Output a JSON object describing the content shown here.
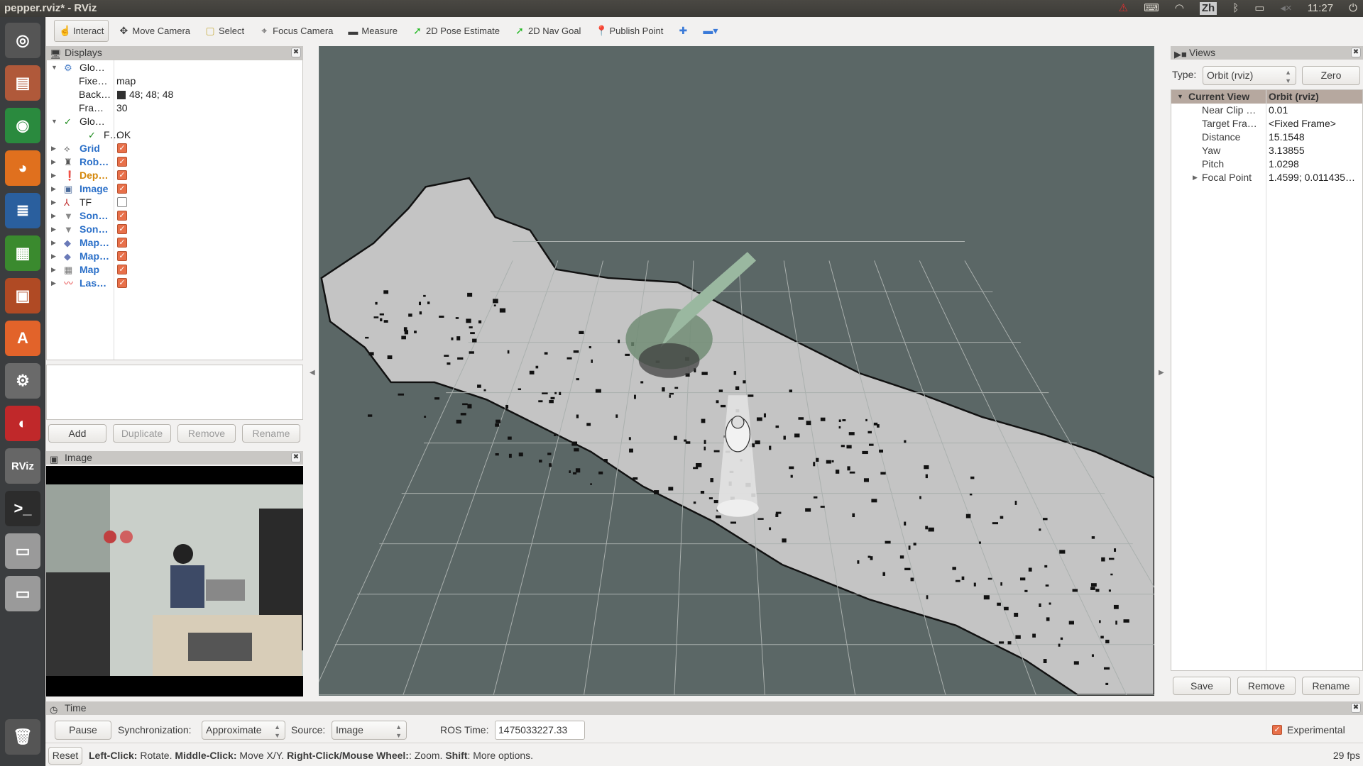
{
  "window": {
    "title": "pepper.rviz* - RViz"
  },
  "tray": {
    "clock": "11:27",
    "input_method": "Zh"
  },
  "launcher": [
    {
      "name": "ubuntu-dash",
      "glyph": "◎",
      "color": "#555"
    },
    {
      "name": "files",
      "glyph": "▤",
      "color": "#b0593a"
    },
    {
      "name": "chrome",
      "glyph": "◉",
      "color": "#2a8a3e"
    },
    {
      "name": "firefox",
      "glyph": "◕",
      "color": "#e0701e"
    },
    {
      "name": "writer",
      "glyph": "≣",
      "color": "#2a5f9e"
    },
    {
      "name": "calc",
      "glyph": "▦",
      "color": "#3a8a2e"
    },
    {
      "name": "impress",
      "glyph": "▣",
      "color": "#b04a24"
    },
    {
      "name": "software-center",
      "glyph": "A",
      "color": "#e2632a"
    },
    {
      "name": "system-settings",
      "glyph": "⚙",
      "color": "#6a6a6a"
    },
    {
      "name": "backup",
      "glyph": "◐",
      "color": "#c0282a"
    },
    {
      "name": "rviz",
      "glyph": "RViz",
      "color": "#666"
    },
    {
      "name": "terminal",
      "glyph": ">_",
      "color": "#2c2c2c"
    },
    {
      "name": "drive-1",
      "glyph": "▭",
      "color": "#9a9a9a"
    },
    {
      "name": "drive-2",
      "glyph": "▭",
      "color": "#9a9a9a"
    }
  ],
  "toolbar": [
    {
      "label": "Interact",
      "icon": "hand-icon",
      "glyph": "☝",
      "active": true
    },
    {
      "label": "Move Camera",
      "icon": "move-camera-icon",
      "glyph": "✥"
    },
    {
      "label": "Select",
      "icon": "select-icon",
      "glyph": "▢"
    },
    {
      "label": "Focus Camera",
      "icon": "focus-camera-icon",
      "glyph": "⌖"
    },
    {
      "label": "Measure",
      "icon": "ruler-icon",
      "glyph": "▬"
    },
    {
      "label": "2D Pose Estimate",
      "icon": "pose-arrow-icon",
      "glyph": "➚"
    },
    {
      "label": "2D Nav Goal",
      "icon": "nav-arrow-icon",
      "glyph": "➚"
    },
    {
      "label": "Publish Point",
      "icon": "map-pin-icon",
      "glyph": "📍"
    },
    {
      "label": "",
      "icon": "plus-icon",
      "glyph": "✚"
    },
    {
      "label": "",
      "icon": "minus-icon",
      "glyph": "▬▾"
    }
  ],
  "displays": {
    "title": "Displays",
    "rows": [
      {
        "label": "Glo…",
        "value": "",
        "indent": 0,
        "expand": "▼",
        "icon": "gear-icon",
        "glyph": "⚙",
        "color": "#222",
        "iconcolor": "#4a7fc8"
      },
      {
        "label": "Fixe…",
        "value": "map",
        "indent": 1,
        "color": "#222"
      },
      {
        "label": "Back…",
        "value": "48; 48; 48",
        "swatch": "#303030",
        "indent": 1,
        "color": "#222"
      },
      {
        "label": "Fra…",
        "value": "30",
        "indent": 1,
        "color": "#222"
      },
      {
        "label": "Glo…",
        "value": "",
        "indent": 0,
        "expand": "▼",
        "icon": "check-icon",
        "glyph": "✓",
        "color": "#222",
        "iconcolor": "#1c8a1c"
      },
      {
        "label": "F…",
        "value": "OK",
        "indent": 1,
        "icon": "check-icon",
        "glyph": "✓",
        "color": "#222",
        "iconcolor": "#1c8a1c"
      },
      {
        "label": "Grid",
        "checked": true,
        "indent": 0,
        "expand": "▶",
        "icon": "grid-icon",
        "glyph": "⟡",
        "color": "#2a6fc8",
        "bold": true
      },
      {
        "label": "Rob…",
        "checked": true,
        "indent": 0,
        "expand": "▶",
        "icon": "robot-model-icon",
        "glyph": "♜",
        "color": "#2a6fc8",
        "bold": true
      },
      {
        "label": "Dep…",
        "checked": true,
        "indent": 0,
        "expand": "▶",
        "icon": "warning-icon",
        "glyph": "❗",
        "color": "#d4870a",
        "bold": true,
        "iconcolor": "#e8871a"
      },
      {
        "label": "Image",
        "checked": true,
        "indent": 0,
        "expand": "▶",
        "icon": "image-icon",
        "glyph": "▣",
        "color": "#2a6fc8",
        "bold": true,
        "iconcolor": "#4a6a9a"
      },
      {
        "label": "TF",
        "checked": false,
        "indent": 0,
        "expand": "▶",
        "icon": "tf-axes-icon",
        "glyph": "⅄",
        "color": "#222",
        "iconcolor": "#c03030"
      },
      {
        "label": "Son…",
        "checked": true,
        "indent": 0,
        "expand": "▶",
        "icon": "sonar-cone-icon",
        "glyph": "▼",
        "color": "#2a6fc8",
        "bold": true,
        "iconcolor": "#888"
      },
      {
        "label": "Son…",
        "checked": true,
        "indent": 0,
        "expand": "▶",
        "icon": "sonar-cone-icon",
        "glyph": "▼",
        "color": "#2a6fc8",
        "bold": true,
        "iconcolor": "#888"
      },
      {
        "label": "Map…",
        "checked": true,
        "indent": 0,
        "expand": "▶",
        "icon": "marker-icon",
        "glyph": "◆",
        "color": "#2a6fc8",
        "bold": true,
        "iconcolor": "#6a7ab8"
      },
      {
        "label": "Map…",
        "checked": true,
        "indent": 0,
        "expand": "▶",
        "icon": "marker-icon",
        "glyph": "◆",
        "color": "#2a6fc8",
        "bold": true,
        "iconcolor": "#6a7ab8"
      },
      {
        "label": "Map",
        "checked": true,
        "indent": 0,
        "expand": "▶",
        "icon": "map-icon",
        "glyph": "▦",
        "color": "#2a6fc8",
        "bold": true,
        "iconcolor": "#777"
      },
      {
        "label": "Las…",
        "checked": true,
        "indent": 0,
        "expand": "▶",
        "icon": "laser-scan-icon",
        "glyph": "〰",
        "color": "#2a6fc8",
        "bold": true,
        "iconcolor": "#e02020"
      }
    ],
    "buttons": {
      "add": "Add",
      "duplicate": "Duplicate",
      "remove": "Remove",
      "rename": "Rename"
    }
  },
  "image_panel": {
    "title": "Image"
  },
  "views": {
    "title": "Views",
    "type_label": "Type:",
    "type_value": "Orbit (rviz)",
    "zero": "Zero",
    "header": {
      "name": "Current View",
      "value": "Orbit (rviz)"
    },
    "rows": [
      {
        "label": "Near Clip …",
        "value": "0.01"
      },
      {
        "label": "Target Fra…",
        "value": "<Fixed Frame>"
      },
      {
        "label": "Distance",
        "value": "15.1548"
      },
      {
        "label": "Yaw",
        "value": "3.13855"
      },
      {
        "label": "Pitch",
        "value": "1.0298"
      },
      {
        "label": "Focal Point",
        "value": "1.4599; 0.011435…",
        "expand": "▶"
      }
    ],
    "buttons": {
      "save": "Save",
      "remove": "Remove",
      "rename": "Rename"
    }
  },
  "time": {
    "title": "Time",
    "pause": "Pause",
    "sync_label": "Synchronization:",
    "sync_value": "Approximate",
    "source_label": "Source:",
    "source_value": "Image",
    "ros_time_label": "ROS Time:",
    "ros_time": "1475033227.33",
    "experimental": "Experimental",
    "experimental_checked": true
  },
  "status": {
    "reset": "Reset",
    "b1": "Left-Click:",
    "t1": " Rotate. ",
    "b2": "Middle-Click:",
    "t2": " Move X/Y. ",
    "b3": "Right-Click/Mouse Wheel:",
    "t3": ": Zoom. ",
    "b4": "Shift",
    "t4": ": More options.",
    "fps": "29 fps"
  },
  "colors": {
    "viewport_bg": "#5b6766",
    "map_free": "#c4c4c4",
    "checkbox": "#e8704a",
    "accent_header": "#b6a89f"
  }
}
